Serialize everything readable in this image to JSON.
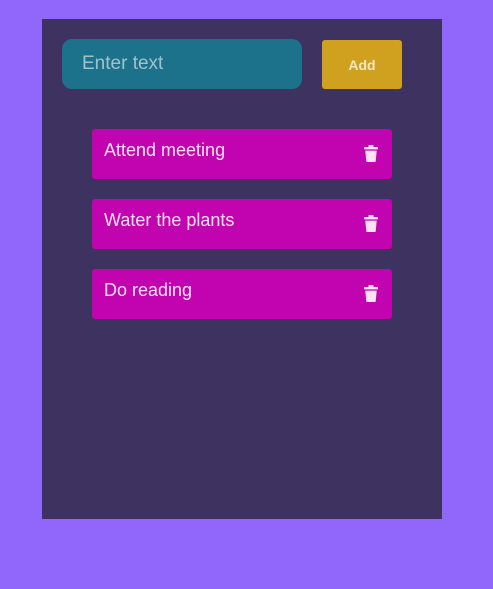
{
  "input": {
    "placeholder": "Enter text",
    "value": ""
  },
  "add_button": {
    "label": "Add"
  },
  "todos": [
    {
      "text": "Attend meeting",
      "icon": "trash-icon"
    },
    {
      "text": "Water the plants",
      "icon": "trash-icon"
    },
    {
      "text": "Do reading",
      "icon": "trash-icon"
    }
  ],
  "colors": {
    "page_background": "#9166fb",
    "panel_background": "#3e3360",
    "input_background": "#1c728b",
    "add_button_background": "#d0a11e",
    "todo_item_background": "#c104b0",
    "todo_text": "#ffe1f7"
  }
}
